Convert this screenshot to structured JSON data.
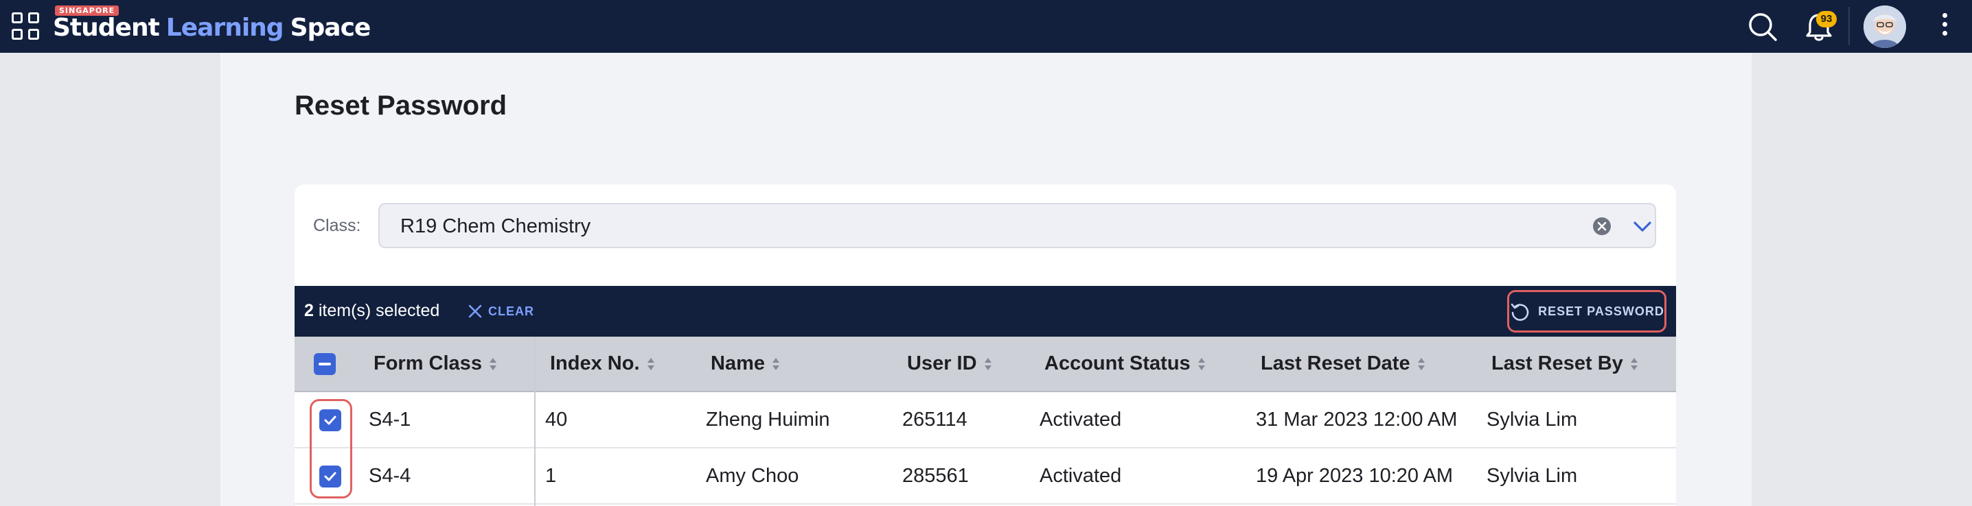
{
  "header": {
    "logo_badge": "SINGAPORE",
    "logo_word1": "Student",
    "logo_word2": "Learning",
    "logo_word3": "Space",
    "notification_count": "93",
    "icons": [
      "apps-grid-icon",
      "search-icon",
      "bell-icon",
      "avatar",
      "more-vertical-icon"
    ]
  },
  "page": {
    "title": "Reset Password"
  },
  "filter": {
    "class_label": "Class:",
    "class_value": "R19 Chem Chemistry"
  },
  "selection_bar": {
    "count": "2",
    "count_suffix": "item(s) selected",
    "clear_label": "CLEAR",
    "reset_label": "RESET PASSWORD"
  },
  "table": {
    "columns": [
      "Form Class",
      "Index No.",
      "Name",
      "User ID",
      "Account Status",
      "Last Reset Date",
      "Last Reset By"
    ],
    "rows": [
      [
        "S4-1",
        "40",
        "Zheng Huimin",
        "265114",
        "Activated",
        "31 Mar 2023 12:00 AM",
        "Sylvia Lim"
      ],
      [
        "S4-4",
        "1",
        "Amy Choo",
        "285561",
        "Activated",
        "19 Apr 2023 10:20 AM",
        "Sylvia Lim"
      ]
    ]
  },
  "colors": {
    "topbar": "#12203e",
    "accent": "#3a63d6",
    "highlight": "#e06060",
    "link": "#7da0ff"
  }
}
